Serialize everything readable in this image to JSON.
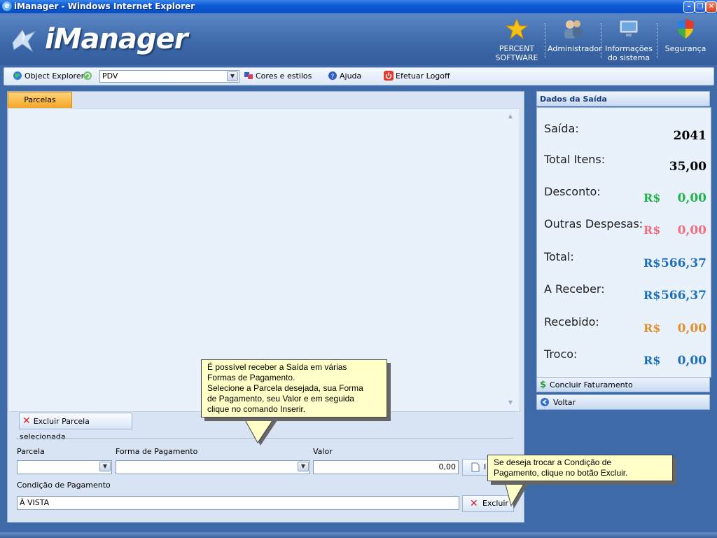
{
  "window": {
    "title": "iManager - Windows Internet Explorer"
  },
  "header": {
    "brand": "iManager",
    "items": [
      {
        "line1": "PERCENT",
        "line2": "SOFTWARE",
        "icon": "star-icon"
      },
      {
        "line1": "Administrador",
        "line2": "",
        "icon": "users-icon"
      },
      {
        "line1": "Informações",
        "line2": "do sistema",
        "icon": "monitor-icon"
      },
      {
        "line1": "Segurança",
        "line2": "",
        "icon": "shield-icon"
      }
    ]
  },
  "toolbar": {
    "object_explorer": "Object Explorer",
    "pdv_value": "PDV",
    "cores": "Cores e estilos",
    "ajuda": "Ajuda",
    "logoff": "Efetuar Logoff"
  },
  "left": {
    "tab": "Parcelas",
    "excluir_parcela": "Excluir Parcela selecionada",
    "labels": {
      "parcela": "Parcela",
      "forma": "Forma de Pagamento",
      "valor": "Valor",
      "condicao": "Condição de Pagamento"
    },
    "valor_value": "0,00",
    "condicao_value": "À VISTA",
    "inserir_label": "I",
    "excluir": "Excluir"
  },
  "tooltips": {
    "tip1": [
      "É possível receber a Saída em várias",
      "Formas de Pagamento.",
      "Selecione a Parcela desejada, sua Forma",
      "de Pagamento, seu Valor e em seguida",
      "clique no comando Inserir."
    ],
    "tip2": [
      "Se deseja trocar a Condição de",
      "Pagamento, clique no botão Excluir."
    ]
  },
  "right": {
    "title": "Dados da Saída",
    "rows": [
      {
        "label": "Saída:",
        "currency": "",
        "value": "2041",
        "color": "#000000"
      },
      {
        "label": "Total Itens:",
        "currency": "",
        "value": "35,00",
        "color": "#000000"
      },
      {
        "label": "Desconto:",
        "currency": "R$",
        "value": "0,00",
        "color": "#22b14c"
      },
      {
        "label": "Outras Despesas:",
        "currency": "R$",
        "value": "0,00",
        "color": "#f26d7d"
      },
      {
        "label": "Total:",
        "currency": "R$",
        "value": "566,37",
        "color": "#1f6fc0"
      },
      {
        "label": "A Receber:",
        "currency": "R$",
        "value": "566,37",
        "color": "#1f6fc0"
      },
      {
        "label": "Recebido:",
        "currency": "R$",
        "value": "0,00",
        "color": "#e09030"
      },
      {
        "label": "Troco:",
        "currency": "R$",
        "value": "0,00",
        "color": "#1f6fc0"
      }
    ],
    "concluir": "Concluir Faturamento",
    "voltar": "Voltar"
  }
}
